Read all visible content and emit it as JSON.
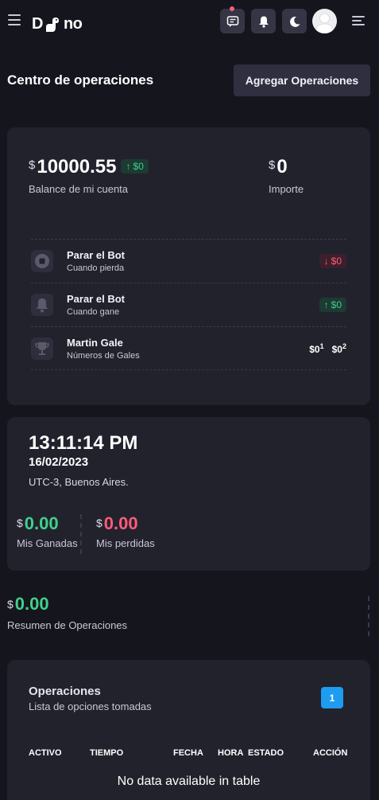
{
  "header": {
    "logo_text_left": "D",
    "logo_text_right": "no",
    "icons": [
      "menu-icon",
      "chat-icon",
      "bell-icon",
      "moon-icon",
      "avatar",
      "menu-icon"
    ]
  },
  "page": {
    "title": "Centro de operaciones",
    "add_button": "Agregar Operaciones"
  },
  "account": {
    "currency": "$",
    "balance": "10000.55",
    "balance_change": "$0",
    "balance_label": "Balance de mi cuenta",
    "importe": "0",
    "importe_label": "Importe"
  },
  "rules": [
    {
      "title": "Parar el Bot",
      "subtitle": "Cuando pierda",
      "value": "$0",
      "icon": "stop-icon"
    },
    {
      "title": "Parar el Bot",
      "subtitle": "Cuando gane",
      "value": "$0",
      "icon": "bell-icon"
    },
    {
      "title": "Martin Gale",
      "subtitle": "Números de Gales",
      "gale1": "$0",
      "gale1_sup": "1",
      "gale2": "$0",
      "gale2_sup": "2",
      "icon": "trophy-icon"
    }
  ],
  "clock": {
    "time": "13:11:14 PM",
    "date": "16/02/2023",
    "timezone": "UTC-3, Buenos Aires."
  },
  "results": {
    "wins": "0.00",
    "wins_label": "Mis Ganadas",
    "losses": "0.00",
    "losses_label": "Mis perdidas"
  },
  "summary": {
    "value": "0.00",
    "label": "Resumen de Operaciones"
  },
  "operations": {
    "title": "Operaciones",
    "subtitle": "Lista de opciones tomadas",
    "count": "1",
    "columns": [
      "ACTIVO",
      "TIEMPO",
      "FECHA",
      "HORA",
      "ESTADO",
      "ACCIÓN"
    ],
    "empty_text": "No data available in table"
  },
  "colors": {
    "background": "#15151e",
    "card": "#22222d",
    "positive": "#3fd18b",
    "negative": "#ff5c7a",
    "accent": "#1e9cf0"
  }
}
